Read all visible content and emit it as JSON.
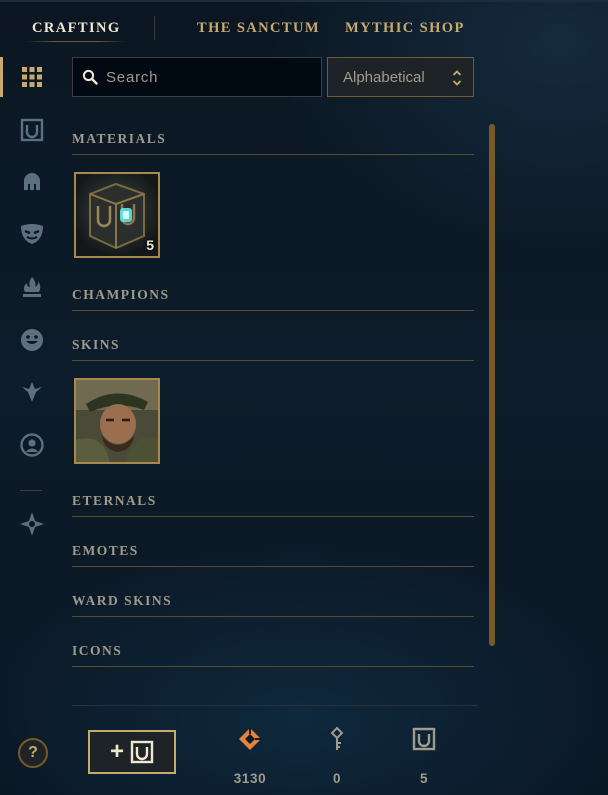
{
  "nav": {
    "tabs": [
      {
        "label": "CRAFTING",
        "active": true
      },
      {
        "label": "THE SANCTUM",
        "active": false
      },
      {
        "label": "MYTHIC SHOP",
        "active": false
      }
    ]
  },
  "side_rail": {
    "icons": [
      "grid-icon",
      "chest-icon",
      "helmet-icon",
      "mask-icon",
      "flame-icon",
      "emote-face-icon",
      "ward-icon",
      "profile-icon",
      "eternals-icon"
    ],
    "active": "grid-icon"
  },
  "search": {
    "placeholder": "Search",
    "value": ""
  },
  "sort": {
    "selected": "Alphabetical"
  },
  "sections": {
    "materials": "MATERIALS",
    "champions": "CHAMPIONS",
    "skins": "SKINS",
    "eternals": "ETERNALS",
    "emotes": "EMOTES",
    "ward_skins": "WARD SKINS",
    "icons": "ICONS"
  },
  "materials_items": [
    {
      "name": "chest",
      "count": "5"
    }
  ],
  "skins_items": [
    {
      "name": "skin-portrait"
    }
  ],
  "footer": {
    "help": "?",
    "add_button": "+",
    "currencies": [
      {
        "icon": "orange-essence-icon",
        "value": "3130"
      },
      {
        "icon": "key-icon",
        "value": "0"
      },
      {
        "icon": "chest-icon",
        "value": "5"
      }
    ]
  },
  "colors": {
    "gold": "#c8aa6e",
    "gold_dark": "#785a28",
    "text": "#a09b8c",
    "bg": "#0a1520",
    "essence": "#e8823a"
  }
}
